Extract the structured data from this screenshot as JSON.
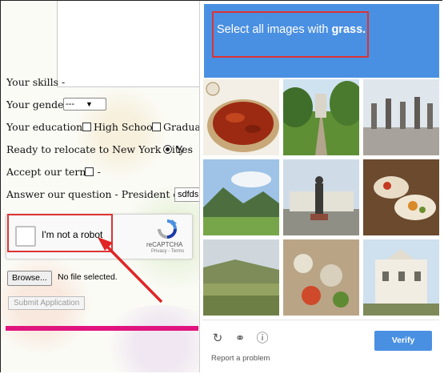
{
  "form": {
    "skills_label": "Your skills -",
    "gender_label": "Your gender -",
    "gender_value": "---",
    "education_label": "Your education -",
    "education_options": [
      "High School",
      "Graduati"
    ],
    "relocate_label": "Ready to relocate to New York City -",
    "relocate_option": "Yes",
    "terms_label": "Accept our terms -",
    "question_label": "Answer our question - President of USA ?",
    "question_value": "sdfds",
    "browse_label": "Browse...",
    "file_status": "No file selected.",
    "submit_label": "Submit Application"
  },
  "recaptcha": {
    "checkbox_label": "I'm not a robot",
    "brand": "reCAPTCHA",
    "links": "Privacy - Terms"
  },
  "challenge": {
    "instruction_prefix": "Select all images with",
    "instruction_target": "grass.",
    "tiles": [
      "chili-flakes-basket",
      "park-path-trees",
      "rooftop-statues",
      "mountain-valley-meadow",
      "statue-square",
      "banquet-food",
      "hillside-fields",
      "market-produce",
      "colonial-building"
    ],
    "report_label": "Report a problem",
    "verify_label": "Verify"
  },
  "colors": {
    "header_blue": "#4a90e2",
    "highlight_red": "#dd3333",
    "accent_pink": "#e0157f"
  }
}
